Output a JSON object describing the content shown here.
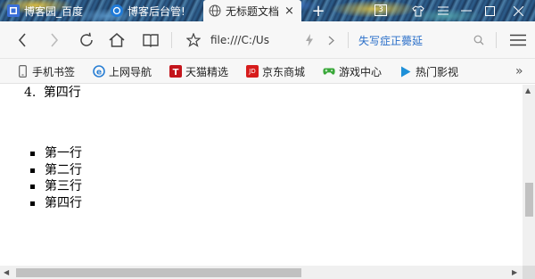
{
  "tabs": [
    {
      "label": "博客园_百度",
      "active": false
    },
    {
      "label": "博客后台管!",
      "active": false
    },
    {
      "label": "无标题文档",
      "active": true
    }
  ],
  "tab_count": "3",
  "address": {
    "url": "file:///C:/Us"
  },
  "search": {
    "text": "失写症正薨延"
  },
  "bookmarks": [
    "手机书签",
    "上网导航",
    "天猫精选",
    "京东商城",
    "游戏中心",
    "热门影视"
  ],
  "bookmarks_more": "»",
  "page": {
    "ordered_visible_item": {
      "number": "4.",
      "text": "第四行"
    },
    "unordered_items": [
      "第一行",
      "第二行",
      "第三行",
      "第四行"
    ]
  },
  "colors": {
    "accent": "#2a6fc9",
    "tab_active_bg": "#f7f7f7"
  }
}
